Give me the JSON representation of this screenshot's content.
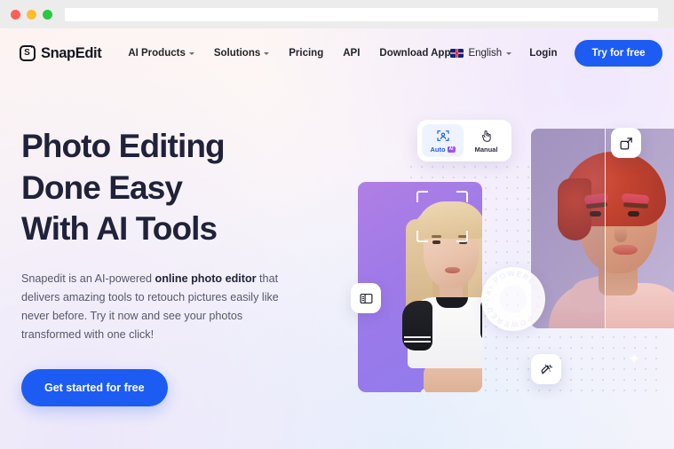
{
  "browser": {
    "traffic_lights": [
      "close-red",
      "minimize-yellow",
      "maximize-green"
    ],
    "url_value": "",
    "url_placeholder": ""
  },
  "header": {
    "logo_text": "SnapEdit",
    "logo_mark": "s-rounded-square-icon",
    "nav_links": [
      {
        "label": "AI Products",
        "has_dropdown": true
      },
      {
        "label": "Solutions",
        "has_dropdown": true
      },
      {
        "label": "Pricing",
        "has_dropdown": false
      },
      {
        "label": "API",
        "has_dropdown": false
      },
      {
        "label": "Download App",
        "has_dropdown": false
      }
    ],
    "language": {
      "label": "English",
      "flag": "uk-flag-icon",
      "has_dropdown": true
    },
    "login_label": "Login",
    "cta_label": "Try for free"
  },
  "hero": {
    "headline_lines": [
      "Photo Editing",
      "Done Easy",
      "With AI Tools"
    ],
    "paragraph": {
      "before": "Snapedit is an AI-powered ",
      "bold": "online photo editor",
      "after": " that delivers amazing tools to retouch pictures easily like never before. Try it now and see your photos transformed with one click!"
    },
    "cta_label": "Get started for free"
  },
  "visual": {
    "mode_toggle": {
      "options": [
        {
          "label": "Auto",
          "icon": "face-detect-icon",
          "badge": "AI",
          "selected": true
        },
        {
          "label": "Manual",
          "icon": "tap-hand-icon",
          "badge": "",
          "selected": false
        }
      ]
    },
    "floating_buttons": [
      {
        "name": "expand-icon"
      },
      {
        "name": "layers-panel-icon"
      },
      {
        "name": "magic-wand-icon"
      }
    ],
    "ai_badge_text": "AI POWERED • AI POWERED • ",
    "face_detect_overlay": "face-detect-brackets"
  },
  "colors": {
    "accent_blue": "#1d5cf3",
    "headline": "#20223a",
    "body_text": "#56586b",
    "badge_gradient_start": "#6d4df6",
    "badge_gradient_end": "#c44df6",
    "chrome_bg": "#ececec"
  }
}
